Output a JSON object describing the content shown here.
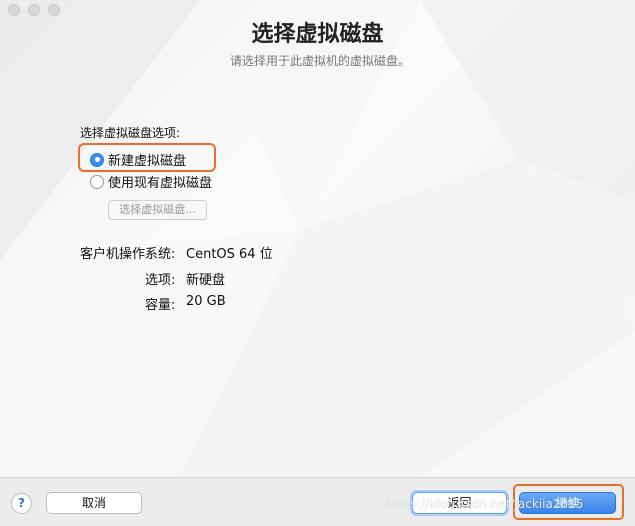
{
  "header": {
    "title": "选择虚拟磁盘",
    "subtitle": "请选择用于此虚拟机的虚拟磁盘。"
  },
  "options": {
    "section_label": "选择虚拟磁盘选项:",
    "radio_new": "新建虚拟磁盘",
    "radio_existing": "使用现有虚拟磁盘",
    "choose_button": "选择虚拟磁盘..."
  },
  "info": {
    "os_label": "客户机操作系统:",
    "os_value": "CentOS 64 位",
    "option_label": "选项:",
    "option_value": "新硬盘",
    "capacity_label": "容量:",
    "capacity_value": "20 GB"
  },
  "footer": {
    "help": "?",
    "cancel": "取消",
    "back": "返回",
    "continue": "继续",
    "watermark": "https://blog.csdn.net/Jackiia2015"
  },
  "colors": {
    "accent": "#3b83ea",
    "highlight": "#e76e2b"
  }
}
